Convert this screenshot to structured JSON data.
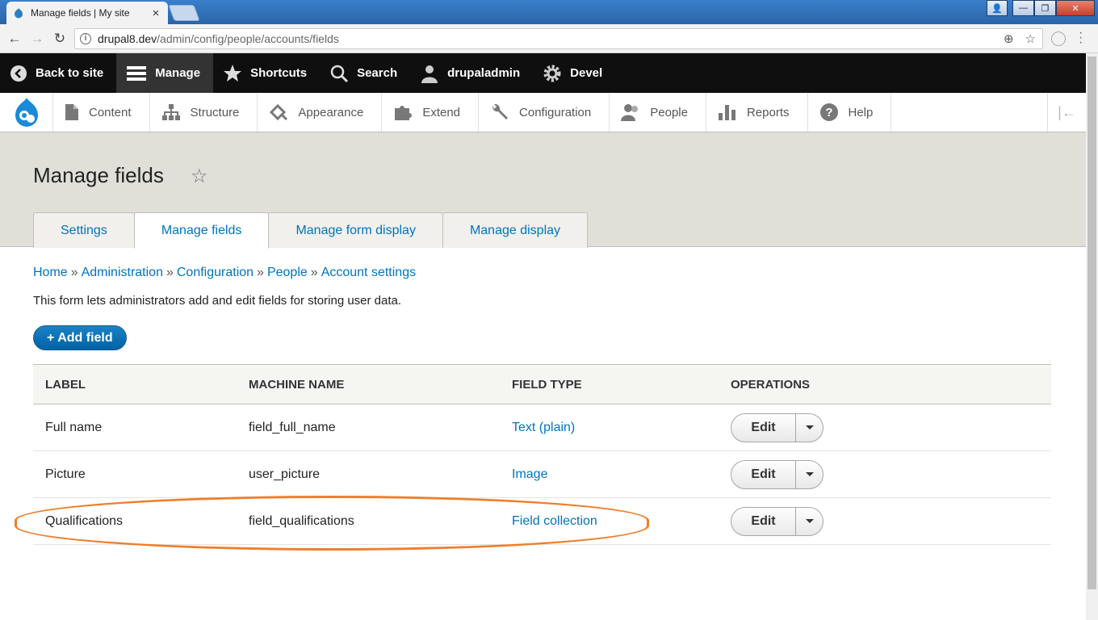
{
  "browser": {
    "tab_title": "Manage fields | My site",
    "url_host": "drupal8.dev",
    "url_path": "/admin/config/people/accounts/fields"
  },
  "admin_bar": {
    "items": [
      "Back to site",
      "Manage",
      "Shortcuts",
      "Search",
      "drupaladmin",
      "Devel"
    ]
  },
  "tray": {
    "items": [
      "Content",
      "Structure",
      "Appearance",
      "Extend",
      "Configuration",
      "People",
      "Reports",
      "Help"
    ]
  },
  "page": {
    "title": "Manage fields",
    "tabs": [
      "Settings",
      "Manage fields",
      "Manage form display",
      "Manage display"
    ],
    "active_tab": "Manage fields",
    "breadcrumb": [
      "Home",
      "Administration",
      "Configuration",
      "People",
      "Account settings"
    ],
    "breadcrumb_sep": "»",
    "description": "This form lets administrators add and edit fields for storing user data.",
    "add_button": "+ Add field"
  },
  "table": {
    "headers": [
      "LABEL",
      "MACHINE NAME",
      "FIELD TYPE",
      "OPERATIONS"
    ],
    "rows": [
      {
        "label": "Full name",
        "machine": "field_full_name",
        "type": "Text (plain)",
        "op": "Edit"
      },
      {
        "label": "Picture",
        "machine": "user_picture",
        "type": "Image",
        "op": "Edit"
      },
      {
        "label": "Qualifications",
        "machine": "field_qualifications",
        "type": "Field collection",
        "op": "Edit"
      }
    ]
  },
  "colors": {
    "link": "#0074bd",
    "highlight": "#ee7f2d",
    "admin_bar": "#0f0f0f"
  }
}
